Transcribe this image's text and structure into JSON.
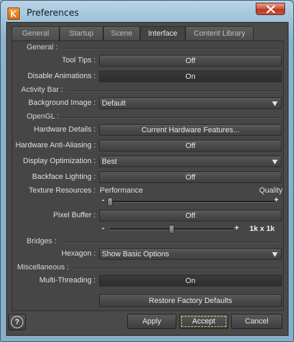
{
  "window": {
    "title": "Preferences"
  },
  "tabs": [
    {
      "label": "General"
    },
    {
      "label": "Startup"
    },
    {
      "label": "Scene"
    },
    {
      "label": "Interface",
      "active": true
    },
    {
      "label": "Content Library"
    }
  ],
  "sections": {
    "general": "General :",
    "activity_bar": "Activity Bar :",
    "opengl": "OpenGL :",
    "bridges": "Bridges :",
    "misc": "Miscellaneous :"
  },
  "general": {
    "tooltips_label": "Tool Tips :",
    "tooltips_value": "Off",
    "disable_anim_label": "Disable Animations :",
    "disable_anim_value": "On"
  },
  "activity_bar": {
    "bg_image_label": "Background Image :",
    "bg_image_value": "Default"
  },
  "opengl": {
    "hw_details_label": "Hardware Details :",
    "hw_details_button": "Current Hardware Features...",
    "aa_label": "Hardware Anti-Aliasing :",
    "aa_value": "Off",
    "display_opt_label": "Display Optimization :",
    "display_opt_value": "Best",
    "backface_label": "Backface Lighting :",
    "backface_value": "Off",
    "texture_label": "Texture Resources :",
    "texture_min_label": "Performance",
    "texture_max_label": "Quality",
    "texture_level": 0.0,
    "pixel_buffer_label": "Pixel Buffer :",
    "pixel_buffer_value": "Off",
    "pixel_buffer_level": 0.5,
    "pixel_buffer_size": "1k x 1k",
    "minus": "-",
    "plus": "+"
  },
  "bridges": {
    "hexagon_label": "Hexagon :",
    "hexagon_value": "Show Basic Options"
  },
  "misc": {
    "mt_label": "Multi-Threading :",
    "mt_value": "On",
    "restore_button": "Restore Factory Defaults"
  },
  "footer": {
    "help": "?",
    "apply": "Apply",
    "accept": "Accept",
    "cancel": "Cancel"
  }
}
